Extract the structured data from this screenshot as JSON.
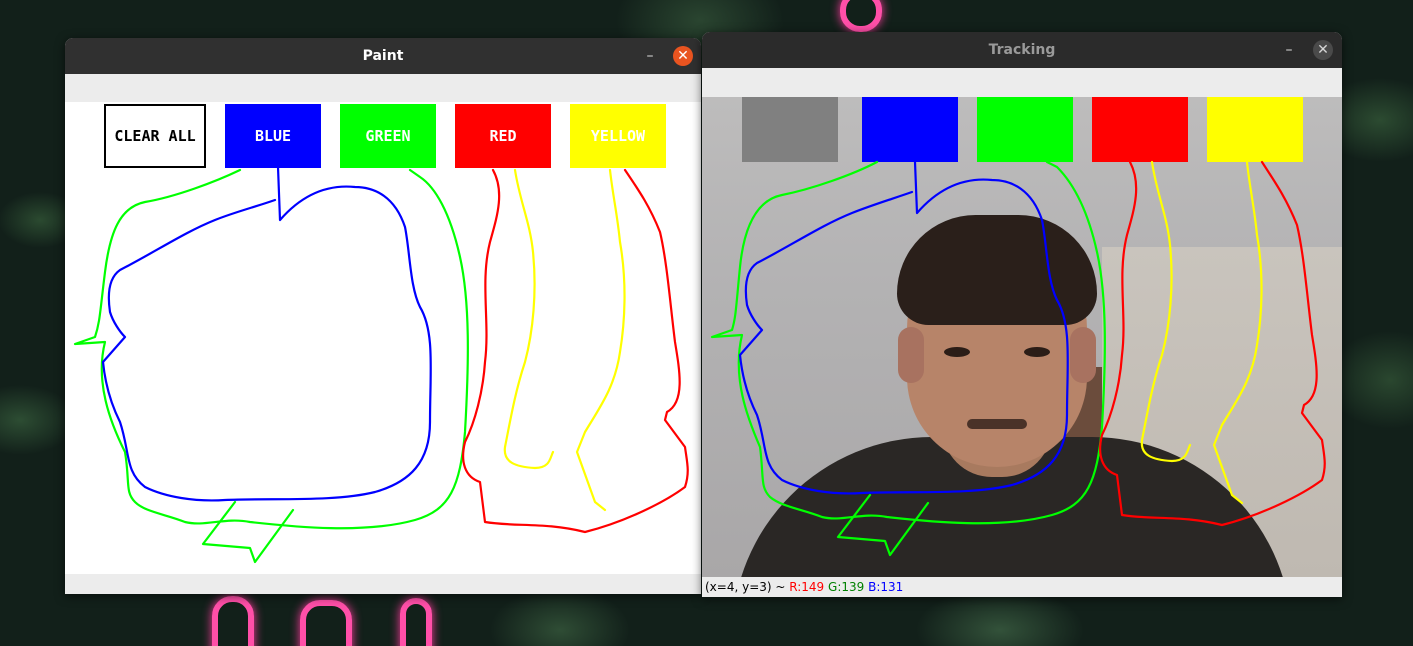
{
  "paint_window": {
    "title": "Paint",
    "minimize_glyph": "–",
    "close_glyph": "✕",
    "buttons": [
      {
        "label": "CLEAR ALL",
        "color": "#ffffff"
      },
      {
        "label": "BLUE",
        "color": "#0000ff"
      },
      {
        "label": "GREEN",
        "color": "#00ff00"
      },
      {
        "label": "RED",
        "color": "#ff0000"
      },
      {
        "label": "YELLOW",
        "color": "#ffff00"
      }
    ]
  },
  "tracking_window": {
    "title": "Tracking",
    "minimize_glyph": "–",
    "close_glyph": "✕",
    "buttons": [
      {
        "color": "#808080"
      },
      {
        "color": "#0000ff"
      },
      {
        "color": "#00ff00"
      },
      {
        "color": "#ff0000"
      },
      {
        "color": "#ffff00"
      }
    ],
    "status": {
      "coords": "(x=4, y=3) ~ ",
      "r": "R:149",
      "g": "G:139",
      "b": "B:131",
      "r_color": "#ff0000",
      "g_color": "#008000",
      "b_color": "#0000ff"
    }
  },
  "stroke_colors": {
    "blue": "#0000ff",
    "green": "#00ff00",
    "red": "#ff0000",
    "yellow": "#ffff00"
  }
}
